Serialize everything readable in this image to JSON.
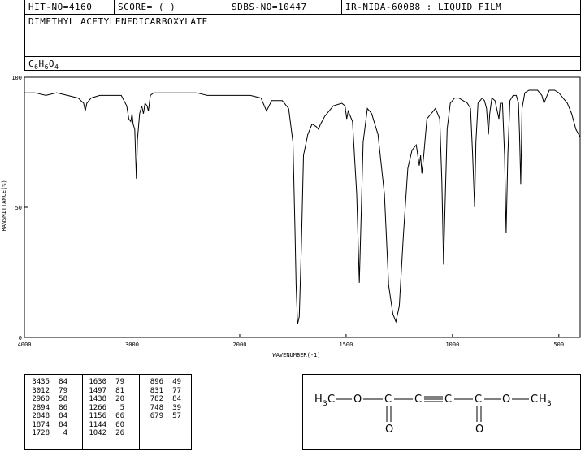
{
  "header": {
    "hit_no": "HIT-NO=4160",
    "score": "SCORE=  (   )",
    "sdbs_no": "SDBS-NO=10447",
    "ir_info": "IR-NIDA-60088 : LIQUID FILM"
  },
  "compound": {
    "name": "DIMETHYL ACETYLENEDICARBOXYLATE",
    "formula_parts": [
      {
        "t": "C",
        "sub": false
      },
      {
        "t": "6",
        "sub": true
      },
      {
        "t": "H",
        "sub": false
      },
      {
        "t": "6",
        "sub": true
      },
      {
        "t": "O",
        "sub": false
      },
      {
        "t": "4",
        "sub": true
      }
    ]
  },
  "chart_data": {
    "type": "line",
    "xlabel": "WAVENUMBER(-1)",
    "ylabel": "TRANSMITTANCE(%)",
    "xlim": [
      4000,
      400
    ],
    "ylim": [
      0,
      100
    ],
    "x_ticks": [
      4000,
      3000,
      2000,
      1500,
      1000,
      500
    ],
    "y_ticks": [
      0,
      50,
      100
    ],
    "spectrum": [
      [
        4000,
        94
      ],
      [
        3900,
        94
      ],
      [
        3800,
        93
      ],
      [
        3700,
        94
      ],
      [
        3600,
        93
      ],
      [
        3500,
        92
      ],
      [
        3450,
        90
      ],
      [
        3435,
        87
      ],
      [
        3420,
        90
      ],
      [
        3380,
        92
      ],
      [
        3300,
        93
      ],
      [
        3200,
        93
      ],
      [
        3100,
        93
      ],
      [
        3050,
        89
      ],
      [
        3030,
        84
      ],
      [
        3012,
        83
      ],
      [
        3000,
        86
      ],
      [
        2990,
        82
      ],
      [
        2975,
        80
      ],
      [
        2960,
        61
      ],
      [
        2950,
        76
      ],
      [
        2930,
        86
      ],
      [
        2910,
        89
      ],
      [
        2894,
        86
      ],
      [
        2880,
        90
      ],
      [
        2860,
        89
      ],
      [
        2848,
        87
      ],
      [
        2830,
        93
      ],
      [
        2800,
        94
      ],
      [
        2700,
        94
      ],
      [
        2600,
        94
      ],
      [
        2500,
        94
      ],
      [
        2400,
        94
      ],
      [
        2300,
        93
      ],
      [
        2200,
        93
      ],
      [
        2100,
        93
      ],
      [
        2000,
        93
      ],
      [
        1950,
        93
      ],
      [
        1900,
        92
      ],
      [
        1874,
        87
      ],
      [
        1850,
        91
      ],
      [
        1800,
        91
      ],
      [
        1770,
        88
      ],
      [
        1750,
        75
      ],
      [
        1740,
        40
      ],
      [
        1735,
        20
      ],
      [
        1728,
        5
      ],
      [
        1720,
        8
      ],
      [
        1710,
        35
      ],
      [
        1700,
        70
      ],
      [
        1680,
        78
      ],
      [
        1660,
        82
      ],
      [
        1640,
        81
      ],
      [
        1630,
        80
      ],
      [
        1620,
        82
      ],
      [
        1600,
        85
      ],
      [
        1560,
        89
      ],
      [
        1520,
        90
      ],
      [
        1505,
        89
      ],
      [
        1497,
        84
      ],
      [
        1490,
        87
      ],
      [
        1470,
        83
      ],
      [
        1450,
        55
      ],
      [
        1438,
        21
      ],
      [
        1430,
        45
      ],
      [
        1420,
        75
      ],
      [
        1400,
        88
      ],
      [
        1380,
        86
      ],
      [
        1350,
        78
      ],
      [
        1320,
        55
      ],
      [
        1300,
        20
      ],
      [
        1280,
        9
      ],
      [
        1266,
        6
      ],
      [
        1250,
        12
      ],
      [
        1230,
        40
      ],
      [
        1210,
        65
      ],
      [
        1190,
        72
      ],
      [
        1170,
        74
      ],
      [
        1156,
        66
      ],
      [
        1150,
        70
      ],
      [
        1144,
        63
      ],
      [
        1135,
        70
      ],
      [
        1120,
        84
      ],
      [
        1100,
        86
      ],
      [
        1080,
        88
      ],
      [
        1060,
        84
      ],
      [
        1050,
        60
      ],
      [
        1042,
        28
      ],
      [
        1035,
        50
      ],
      [
        1025,
        80
      ],
      [
        1010,
        90
      ],
      [
        990,
        92
      ],
      [
        970,
        92
      ],
      [
        950,
        91
      ],
      [
        930,
        90
      ],
      [
        915,
        88
      ],
      [
        905,
        70
      ],
      [
        896,
        50
      ],
      [
        890,
        75
      ],
      [
        880,
        90
      ],
      [
        860,
        92
      ],
      [
        850,
        91
      ],
      [
        840,
        88
      ],
      [
        831,
        78
      ],
      [
        825,
        86
      ],
      [
        815,
        92
      ],
      [
        800,
        91
      ],
      [
        782,
        84
      ],
      [
        775,
        90
      ],
      [
        765,
        90
      ],
      [
        755,
        70
      ],
      [
        748,
        40
      ],
      [
        740,
        70
      ],
      [
        730,
        91
      ],
      [
        715,
        93
      ],
      [
        700,
        93
      ],
      [
        690,
        90
      ],
      [
        685,
        78
      ],
      [
        679,
        59
      ],
      [
        673,
        88
      ],
      [
        660,
        94
      ],
      [
        640,
        95
      ],
      [
        620,
        95
      ],
      [
        600,
        95
      ],
      [
        580,
        93
      ],
      [
        570,
        90
      ],
      [
        560,
        92
      ],
      [
        545,
        95
      ],
      [
        520,
        95
      ],
      [
        500,
        94
      ],
      [
        480,
        92
      ],
      [
        460,
        90
      ],
      [
        440,
        86
      ],
      [
        420,
        80
      ],
      [
        400,
        77
      ]
    ]
  },
  "peak_table": {
    "columns": [
      [
        [
          "3435",
          "84"
        ],
        [
          "3012",
          "79"
        ],
        [
          "2960",
          "58"
        ],
        [
          "2894",
          "86"
        ],
        [
          "2848",
          "84"
        ],
        [
          "1874",
          "84"
        ],
        [
          "1728",
          "4"
        ]
      ],
      [
        [
          "1630",
          "79"
        ],
        [
          "1497",
          "81"
        ],
        [
          "1438",
          "20"
        ],
        [
          "1266",
          "5"
        ],
        [
          "1156",
          "66"
        ],
        [
          "1144",
          "60"
        ],
        [
          "1042",
          "26"
        ]
      ],
      [
        [
          "896",
          "49"
        ],
        [
          "831",
          "77"
        ],
        [
          "782",
          "84"
        ],
        [
          "748",
          "39"
        ],
        [
          "679",
          "57"
        ]
      ]
    ]
  },
  "structure": {
    "left_group": "H₃C–O–C",
    "alkyne": "C≡C",
    "right_group": "C–O–CH₃",
    "o_left": "O",
    "o_right": "O",
    "parts": [
      "H",
      "3",
      "C",
      "O",
      "C",
      "C",
      "C",
      "C",
      "O",
      "C",
      "H",
      "3",
      "O",
      "O"
    ]
  }
}
